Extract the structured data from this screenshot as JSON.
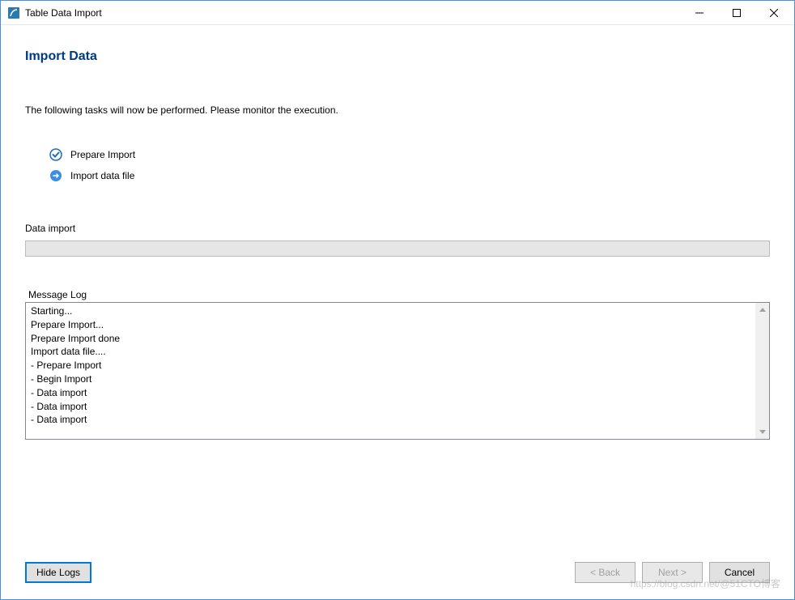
{
  "window": {
    "title": "Table Data Import"
  },
  "page": {
    "heading": "Import Data",
    "instruction": "The following tasks will now be performed. Please monitor the execution."
  },
  "tasks": [
    {
      "label": "Prepare Import",
      "status": "done"
    },
    {
      "label": "Import data file",
      "status": "running"
    }
  ],
  "progress": {
    "label": "Data import"
  },
  "messageLog": {
    "label": "Message Log",
    "lines": [
      "Starting...",
      "Prepare Import...",
      "Prepare Import done",
      "Import data file....",
      " - Prepare Import",
      " - Begin Import",
      " - Data import",
      " - Data import",
      " - Data import"
    ]
  },
  "buttons": {
    "hideLogs": "Hide Logs",
    "back": "< Back",
    "next": "Next >",
    "cancel": "Cancel"
  },
  "watermark": "https://blog.csdn.net/@51CTO博客"
}
